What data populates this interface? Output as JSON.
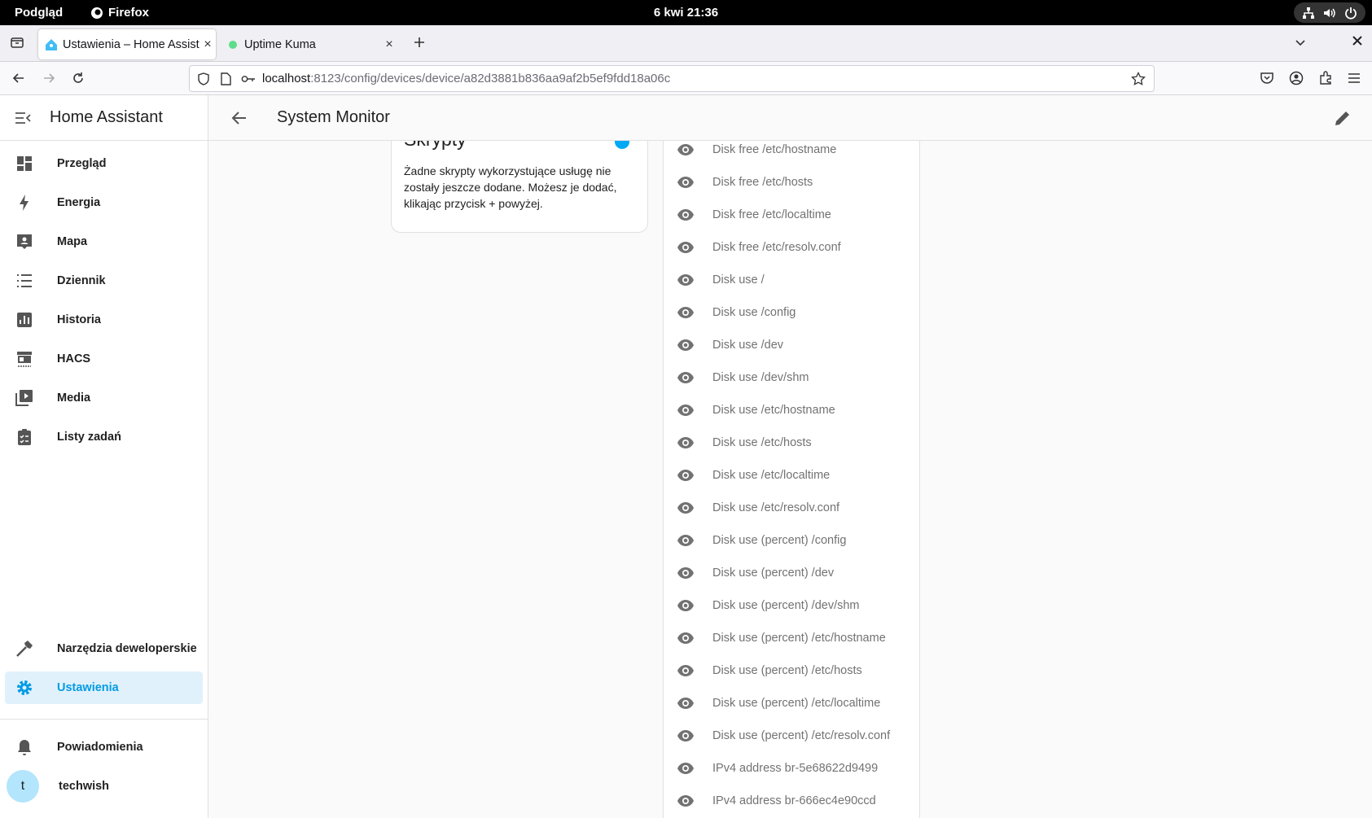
{
  "os": {
    "activities": "Podgląd",
    "app_name": "Firefox",
    "clock": "6 kwi  21:36"
  },
  "browser": {
    "tabs": [
      {
        "title": "Ustawienia – Home Assist",
        "active": true
      },
      {
        "title": "Uptime Kuma",
        "active": false
      }
    ],
    "url_host": "localhost",
    "url_path": ":8123/config/devices/device/a82d3881b836aa9af2b5ef9fdd18a06c"
  },
  "sidebar": {
    "brand": "Home Assistant",
    "items": [
      {
        "label": "Przegląd",
        "icon": "dashboard-icon"
      },
      {
        "label": "Energia",
        "icon": "lightning-icon"
      },
      {
        "label": "Mapa",
        "icon": "map-icon"
      },
      {
        "label": "Dziennik",
        "icon": "logbook-icon"
      },
      {
        "label": "Historia",
        "icon": "history-icon"
      },
      {
        "label": "HACS",
        "icon": "hacs-icon"
      },
      {
        "label": "Media",
        "icon": "media-icon"
      },
      {
        "label": "Listy zadań",
        "icon": "todo-icon"
      }
    ],
    "dev_tools": "Narzędzia deweloperskie",
    "settings": "Ustawienia",
    "notifications": "Powiadomienia",
    "user_initial": "t",
    "user_name": "techwish"
  },
  "header": {
    "title": "System Monitor"
  },
  "scripts_card": {
    "title": "Skrypty",
    "text": "Żadne skrypty wykorzystujące usługę nie zostały jeszcze dodane. Możesz je dodać, klikając przycisk + powyżej."
  },
  "entities": [
    "Disk free /etc/hostname",
    "Disk free /etc/hosts",
    "Disk free /etc/localtime",
    "Disk free /etc/resolv.conf",
    "Disk use /",
    "Disk use /config",
    "Disk use /dev",
    "Disk use /dev/shm",
    "Disk use /etc/hostname",
    "Disk use /etc/hosts",
    "Disk use /etc/localtime",
    "Disk use /etc/resolv.conf",
    "Disk use (percent) /config",
    "Disk use (percent) /dev",
    "Disk use (percent) /dev/shm",
    "Disk use (percent) /etc/hostname",
    "Disk use (percent) /etc/hosts",
    "Disk use (percent) /etc/localtime",
    "Disk use (percent) /etc/resolv.conf",
    "IPv4 address br-5e68622d9499",
    "IPv4 address br-666ec4e90ccd"
  ],
  "colors": {
    "accent": "#03a9f4",
    "active_bg": "#e1f1fb",
    "icon_grey": "#727272"
  }
}
